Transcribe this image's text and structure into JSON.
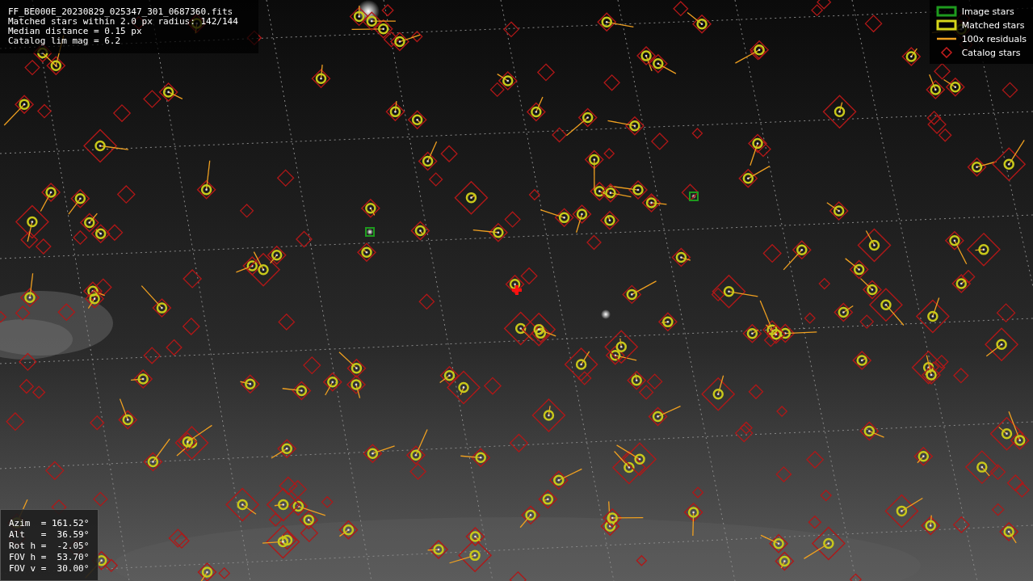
{
  "info": {
    "lines": [
      "FF_BE000E_20230829_025347_301_0687360.fits",
      "Matched stars within 2.0 px radius: 142/144",
      "Median distance = 0.15 px",
      "Catalog lim mag = 6.2"
    ]
  },
  "legend": [
    {
      "kind": "square",
      "label": "Image stars",
      "color": "#1e9a1e"
    },
    {
      "kind": "square",
      "label": "Matched stars",
      "color": "#d6d61a"
    },
    {
      "kind": "line",
      "label": "100x residuals",
      "color": "#f0a020"
    },
    {
      "kind": "diamond",
      "label": "Catalog stars",
      "color": "#c81e1e"
    }
  ],
  "pointing": {
    "lines": [
      "Azim  = 161.52°",
      "Alt   =  36.59°",
      "Rot h =  -2.05°",
      "FOV h =  53.70°",
      "FOV v =  30.00°"
    ]
  }
}
